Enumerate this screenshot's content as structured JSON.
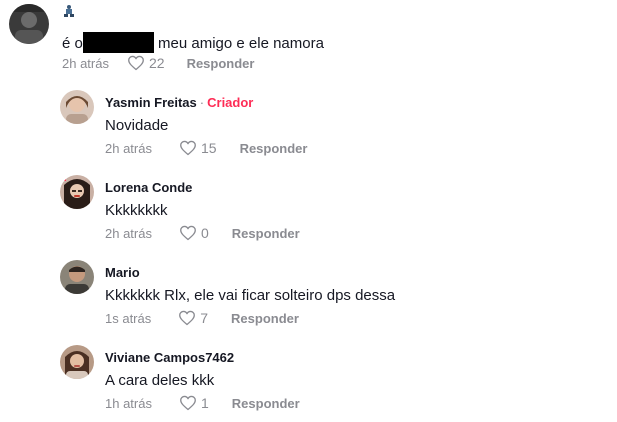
{
  "main_comment": {
    "text_prefix": "é o",
    "text_suffix": "meu amigo e ele namora",
    "time": "2h atrás",
    "likes": "22",
    "reply_label": "Responder"
  },
  "replies": [
    {
      "username": "Yasmin Freitas",
      "separator": "·",
      "creator_label": "Criador",
      "text": "Novidade",
      "time": "2h atrás",
      "likes": "15",
      "reply_label": "Responder"
    },
    {
      "username": "Lorena Conde",
      "text": "Kkkkkkkk",
      "time": "2h atrás",
      "likes": "0",
      "reply_label": "Responder"
    },
    {
      "username": "Mario",
      "text": "Kkkkkkk Rlx, ele vai ficar solteiro dps dessa",
      "time": "1s atrás",
      "likes": "7",
      "reply_label": "Responder"
    },
    {
      "username": "Viviane Campos7462",
      "text": "A cara deles kkk",
      "time": "1h atrás",
      "likes": "1",
      "reply_label": "Responder"
    }
  ],
  "icons": {
    "like": "heart-outline-icon",
    "user_badge": "figure-sticker-icon"
  },
  "colors": {
    "creator": "#fe2c55",
    "secondary_text": "#8a8b91",
    "primary_text": "#161823"
  }
}
